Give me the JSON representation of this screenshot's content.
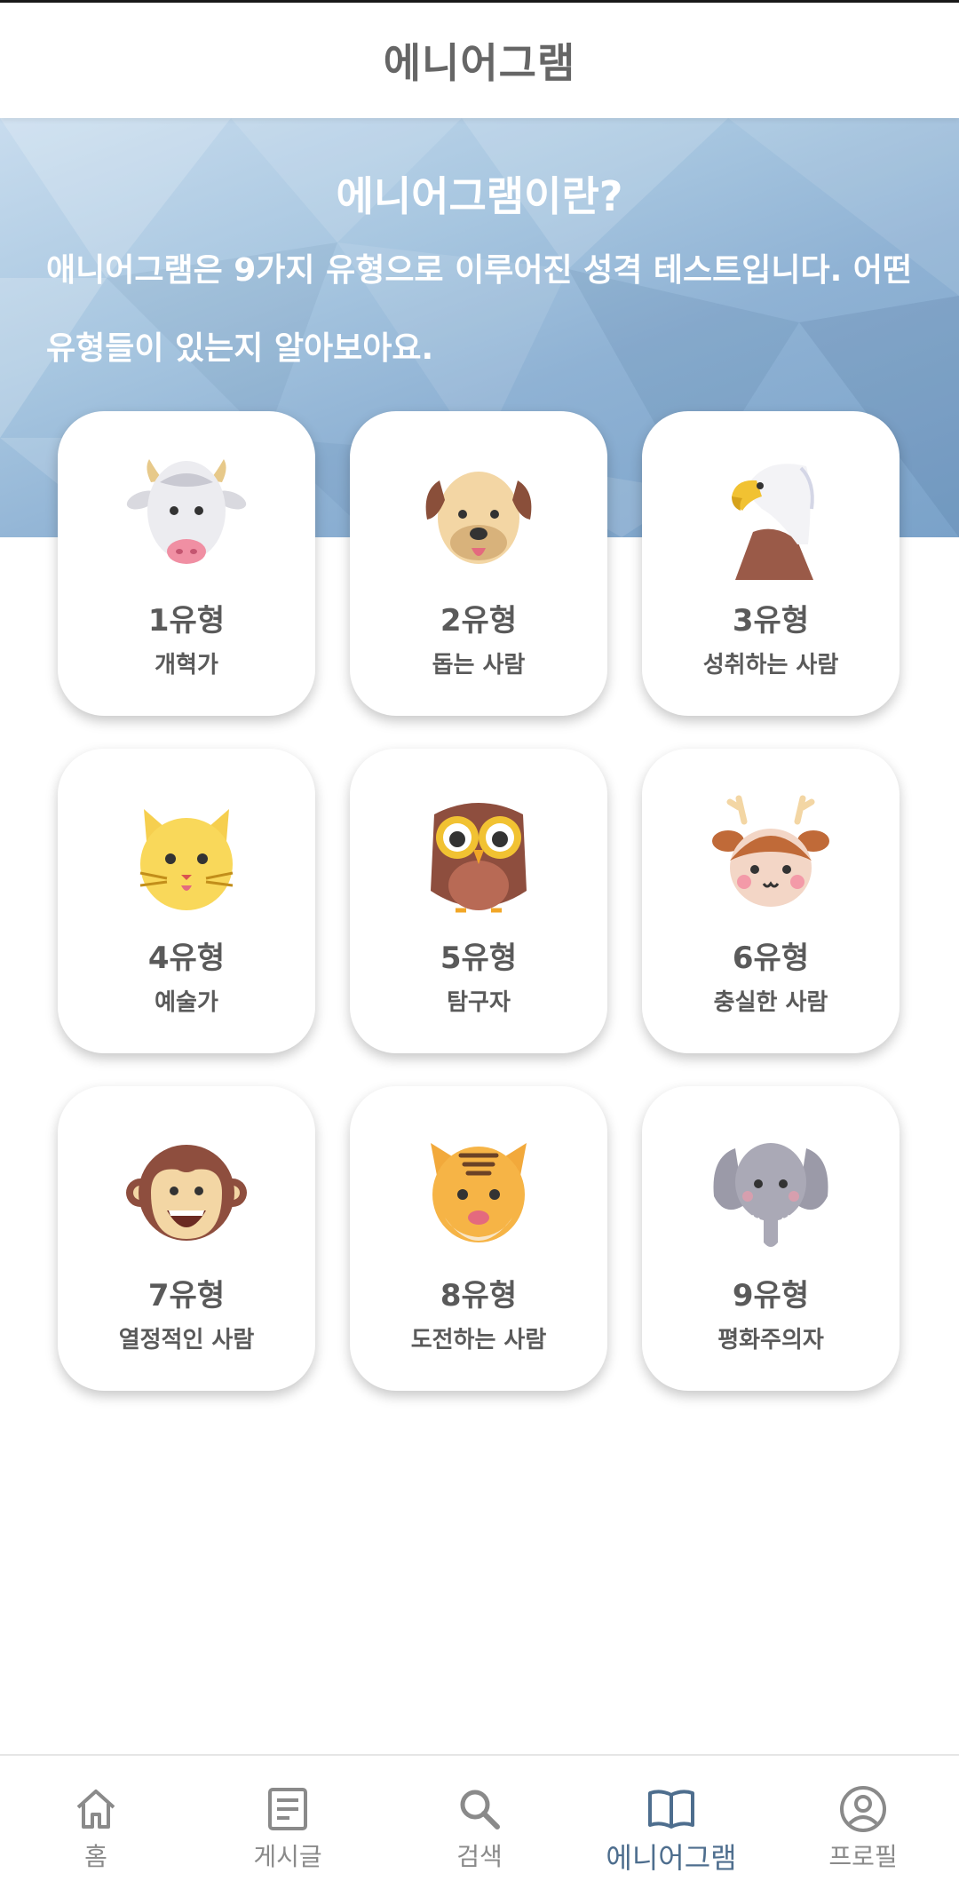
{
  "header": {
    "title": "에니어그램"
  },
  "hero": {
    "title": "에니어그램이란?",
    "description": "애니어그램은 9가지 유형으로 이루어진 성격 테스트입니다. 어떤 유형들이 있는지 알아보아요."
  },
  "types": [
    {
      "type": "1유형",
      "name": "개혁가",
      "icon": "cow-icon"
    },
    {
      "type": "2유형",
      "name": "돕는 사람",
      "icon": "dog-icon"
    },
    {
      "type": "3유형",
      "name": "성취하는 사람",
      "icon": "eagle-icon"
    },
    {
      "type": "4유형",
      "name": "예술가",
      "icon": "cat-icon"
    },
    {
      "type": "5유형",
      "name": "탐구자",
      "icon": "owl-icon"
    },
    {
      "type": "6유형",
      "name": "충실한 사람",
      "icon": "deer-icon"
    },
    {
      "type": "7유형",
      "name": "열정적인 사람",
      "icon": "monkey-icon"
    },
    {
      "type": "8유형",
      "name": "도전하는 사람",
      "icon": "tiger-icon"
    },
    {
      "type": "9유형",
      "name": "평화주의자",
      "icon": "elephant-icon"
    }
  ],
  "nav": {
    "items": [
      {
        "label": "홈",
        "icon": "home-icon"
      },
      {
        "label": "게시글",
        "icon": "document-icon"
      },
      {
        "label": "검색",
        "icon": "search-icon"
      },
      {
        "label": "에니어그램",
        "icon": "book-icon",
        "active": true
      },
      {
        "label": "프로필",
        "icon": "profile-icon"
      }
    ]
  },
  "colors": {
    "accent": "#4e6e8e",
    "hero": "#8fb2d4",
    "text": "#5a5a5a"
  }
}
